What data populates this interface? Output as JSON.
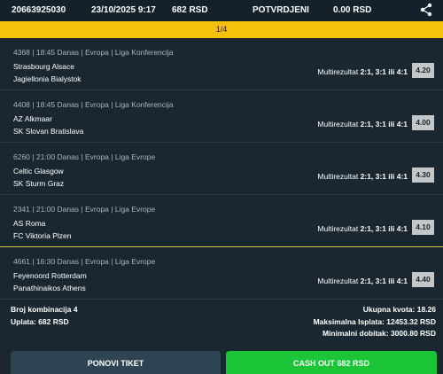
{
  "header": {
    "ticket_id": "20663925030",
    "datetime": "23/10/2025 9:17",
    "stake": "682 RSD",
    "status": "POTVRDJENI",
    "payout": "0.00 RSD"
  },
  "pager": "1/4",
  "matches": [
    {
      "meta": "4368 | 18:45 Danas | Evropa | Liga Konferencija",
      "home": "Strasbourg Alsace",
      "away": "Jagiellonia Bialystok",
      "market": "Multirezultat",
      "pick": "2:1, 3:1 ili 4:1",
      "odd": "4.20"
    },
    {
      "meta": "4408 | 18:45 Danas | Evropa | Liga Konferencija",
      "home": "AZ Alkmaar",
      "away": "SK Slovan Bratislava",
      "market": "Multirezultat",
      "pick": "2:1, 3:1 ili 4:1",
      "odd": "4.00"
    },
    {
      "meta": "6260 | 21:00 Danas | Evropa | Liga Evrope",
      "home": "Celtic Glasgow",
      "away": "SK Sturm Graz",
      "market": "Multirezultat",
      "pick": "2:1, 3:1 ili 4:1",
      "odd": "4.30"
    },
    {
      "meta": "2341 | 21:00 Danas | Evropa | Liga Evrope",
      "home": "AS Roma",
      "away": "FC Viktoria Plzen",
      "market": "Multirezultat",
      "pick": "2:1, 3:1 ili 4:1",
      "odd": "4.10"
    },
    {
      "meta": "4661 | 16:30 Danas | Evropa | Liga Evrope",
      "home": "Feyenoord Rotterdam",
      "away": "Panathinaikos Athens",
      "market": "Multirezultat",
      "pick": "2:1, 3:1 ili 4:1",
      "odd": "4.40"
    }
  ],
  "summary": {
    "combinations": "Broj kombinacija 4",
    "stake": "Uplata: 682 RSD",
    "total_odds": "Ukupna kvota: 18.26",
    "max_payout": "Maksimalna Isplata: 12453.32 RSD",
    "min_win": "Minimalni dobitak: 3000.80 RSD"
  },
  "buttons": {
    "repeat": "PONOVI TIKET",
    "cashout": "CASH OUT 682 RSD"
  },
  "icons": {
    "share": "share-icon"
  }
}
